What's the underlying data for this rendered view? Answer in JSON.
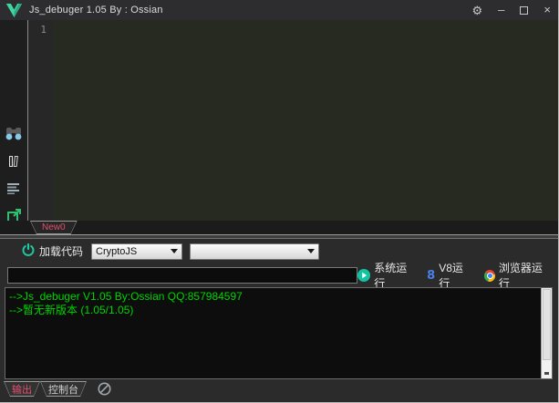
{
  "window": {
    "title": "Js_debuger 1.05 By : Ossian"
  },
  "titlebar_controls": {
    "settings_glyph": "⚙",
    "minimize_glyph": "–",
    "close_glyph": "×"
  },
  "editor": {
    "line_number": "1",
    "tab_label": "New0"
  },
  "sidebar": {
    "icons": [
      "binoculars-search-icon",
      "files-compare-icon",
      "format-lines-icon",
      "open-external-icon"
    ]
  },
  "toolbar": {
    "load_code_label": "加载代码",
    "library_select_value": "CryptoJS",
    "secondary_select_value": ""
  },
  "run_bar": {
    "command_input_value": "",
    "system_run_label": "系统运行",
    "v8_run_label": "V8运行",
    "v8_icon_glyph": "8",
    "browser_run_label": "浏览器运行"
  },
  "output_panel": {
    "lines": [
      "-->Js_debuger V1.05 By:Ossian QQ:857984597",
      "-->暂无新版本 (1.05/1.05)"
    ]
  },
  "bottom_tabs": {
    "output_label": "输出",
    "console_label": "控制台"
  },
  "colors": {
    "accent_teal": "#1dc8a2",
    "tab_red": "#e0506e",
    "output_green": "#00d400",
    "v8_blue": "#4a7fe8",
    "titlebar_bg": "#2d2d30",
    "editor_bg": "#262a20",
    "output_bg": "#0d0d0d"
  }
}
